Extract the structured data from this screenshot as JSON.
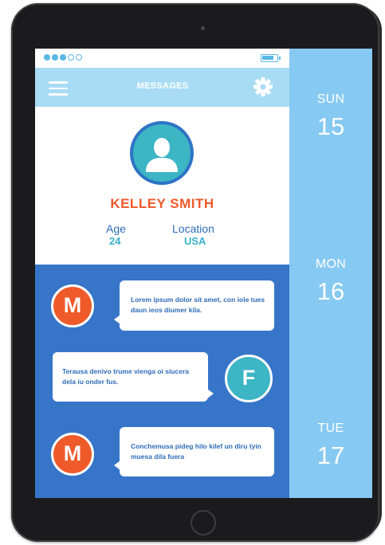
{
  "colors": {
    "header_bg": "#a8dcf4",
    "accent_blue": "#2e73c6",
    "messages_bg": "#3775c9",
    "calendar_bg": "#86c9f2",
    "name_orange": "#ef5a2a",
    "teal": "#3cb5c5"
  },
  "status_bar": {
    "signal_dots_filled": 3,
    "signal_dots_total": 5,
    "battery_level": 0.8
  },
  "header": {
    "title": "MESSAGES",
    "menu_icon": "hamburger-menu-icon",
    "settings_icon": "gear-icon"
  },
  "profile": {
    "avatar_icon": "user-silhouette-icon",
    "name": "KELLEY SMITH",
    "age_label": "Age",
    "age_value": "24",
    "location_label": "Location",
    "location_value": "USA"
  },
  "messages": [
    {
      "sender_initial": "M",
      "text": "Lorem ipsum dolor sit amet, con iole tues daun ieos diumer kila."
    },
    {
      "sender_initial": "F",
      "text": "Terausa denivo trume vienga oi siucera dela iu onder fus."
    },
    {
      "sender_initial": "M",
      "text": "Conchemusa pideg hilo kilef un diru tyin muesa dila fuera"
    }
  ],
  "calendar": [
    {
      "day": "SUN",
      "date": "15"
    },
    {
      "day": "MON",
      "date": "16"
    },
    {
      "day": "TUE",
      "date": "17"
    }
  ]
}
